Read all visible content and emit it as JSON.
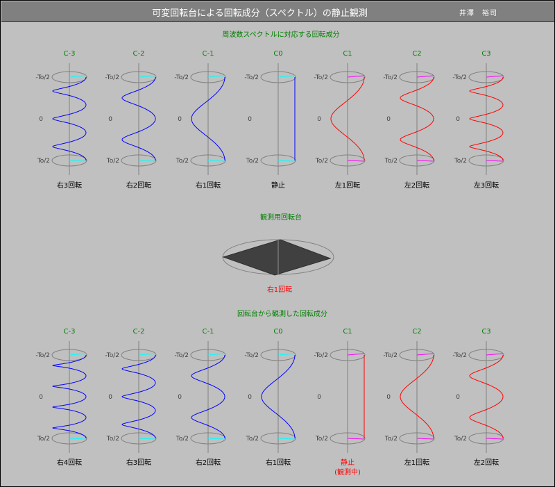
{
  "window": {
    "title": "可変回転台による回転成分（スペクトル）の静止観測",
    "author": "井澤　裕司"
  },
  "top_section": {
    "heading": "周波数スペクトルに対応する回転成分",
    "columns": [
      {
        "label": "C-3",
        "caption": "右3回転",
        "turns": -3
      },
      {
        "label": "C-2",
        "caption": "右2回転",
        "turns": -2
      },
      {
        "label": "C-1",
        "caption": "右1回転",
        "turns": -1
      },
      {
        "label": "C0",
        "caption": "静止",
        "turns": 0
      },
      {
        "label": "C1",
        "caption": "左1回転",
        "turns": 1
      },
      {
        "label": "C2",
        "caption": "左2回転",
        "turns": 2
      },
      {
        "label": "C3",
        "caption": "左3回転",
        "turns": 3
      }
    ]
  },
  "platform": {
    "heading": "観測用回転台",
    "caption": "右1回転"
  },
  "bottom_section": {
    "heading": "回転台から観測した回転成分",
    "columns": [
      {
        "label": "C-3",
        "caption": "右4回転",
        "turns": -4
      },
      {
        "label": "C-2",
        "caption": "右3回転",
        "turns": -3
      },
      {
        "label": "C-1",
        "caption": "右2回転",
        "turns": -2
      },
      {
        "label": "C0",
        "caption": "右1回転",
        "turns": -1
      },
      {
        "label": "C1",
        "caption": "静止",
        "caption2": "(観測中)",
        "turns": 0,
        "highlight": true
      },
      {
        "label": "C2",
        "caption": "左1回転",
        "turns": 1
      },
      {
        "label": "C3",
        "caption": "左2回転",
        "turns": 2
      }
    ]
  },
  "axis_labels": {
    "top": "-To/2",
    "middle": "0",
    "bottom": "To/2"
  },
  "colors": {
    "background": "#c0c0c0",
    "titlebar": "#808080",
    "heading_green": "#008000",
    "label_green": "#008000",
    "right_rotation": "#0000ff",
    "left_rotation": "#ff0000",
    "arrow_right": "#00ffff",
    "arrow_left": "#ff00ff",
    "highlight_red": "#ff0000",
    "axis_gray": "#808080",
    "platform_top": "#404040"
  }
}
